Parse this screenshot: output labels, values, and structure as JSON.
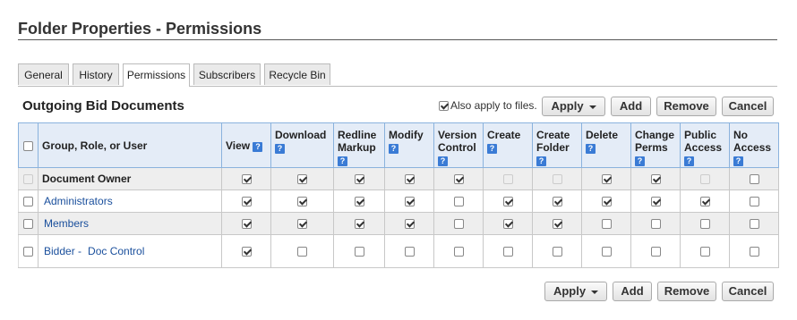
{
  "page": {
    "title": "Folder Properties - Permissions"
  },
  "tabs": [
    {
      "label": "General"
    },
    {
      "label": "History"
    },
    {
      "label": "Permissions",
      "active": true
    },
    {
      "label": "Subscribers"
    },
    {
      "label": "Recycle Bin"
    }
  ],
  "section": {
    "title": "Outgoing Bid Documents",
    "also_apply_label": "Also apply to files.",
    "also_apply_checked": true
  },
  "buttons": {
    "apply": "Apply",
    "add": "Add",
    "remove": "Remove",
    "cancel": "Cancel"
  },
  "table": {
    "header_group": "Group, Role, or User",
    "columns": [
      "View",
      "Download",
      "Redline Markup",
      "Modify",
      "Version Control",
      "Create",
      "Create Folder",
      "Delete",
      "Change Perms",
      "Public Access",
      "No Access"
    ],
    "help_icon": "question-mark-icon",
    "rows": [
      {
        "name": "Document Owner",
        "bold": true,
        "perms": [
          "on",
          "on",
          "on",
          "on",
          "on",
          "dis",
          "dis",
          "on",
          "on",
          "dis",
          "off"
        ]
      },
      {
        "name": "Administrators",
        "link": true,
        "perms": [
          "on",
          "on",
          "on",
          "on",
          "off",
          "on",
          "on",
          "on",
          "on",
          "on",
          "off"
        ]
      },
      {
        "name": "Members",
        "link": true,
        "perms": [
          "on",
          "on",
          "on",
          "on",
          "off",
          "on",
          "on",
          "off",
          "off",
          "off",
          "off"
        ]
      },
      {
        "name": "Bidder -",
        "sub": "Doc Control",
        "link": true,
        "perms": [
          "on",
          "off",
          "off",
          "off",
          "off",
          "off",
          "off",
          "off",
          "off",
          "off",
          "off"
        ]
      }
    ]
  },
  "colors": {
    "header_bg": "#e4ecf7",
    "header_border": "#8ab2dd",
    "link": "#1a4f9c",
    "help_icon": "#3a7bd5"
  }
}
